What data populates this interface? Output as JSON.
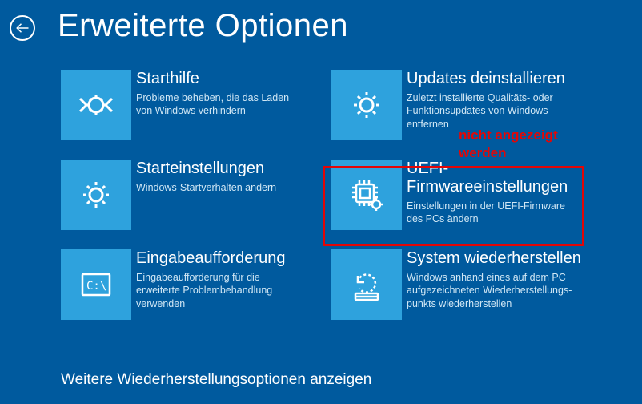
{
  "header": {
    "title": "Erweiterte Optionen"
  },
  "tiles": [
    {
      "title": "Starthilfe",
      "desc": "Probleme beheben, die das Laden von Windows verhindern"
    },
    {
      "title": "Updates deinstallieren",
      "desc": "Zuletzt installierte Qualitäts- oder Funktionsupdates von Windows entfernen"
    },
    {
      "title": "Starteinstellungen",
      "desc": "Windows-Startverhalten ändern"
    },
    {
      "title": "UEFI-Firmwareeinstellungen",
      "desc": "Einstellungen in der UEFI-Firmware des PCs ändern"
    },
    {
      "title": "Eingabeaufforderung",
      "desc": "Eingabeaufforderung für die erweiterte Problembehandlung verwenden"
    },
    {
      "title": "System wiederherstellen",
      "desc": "Windows anhand eines auf dem PC aufgezeichneten Wiederherstellungs­punkts wiederherstellen"
    }
  ],
  "more_link": "Weitere Wiederherstellungsoptionen anzeigen",
  "annotation": {
    "line1": "nicht angezeigt",
    "line2": "werden"
  }
}
